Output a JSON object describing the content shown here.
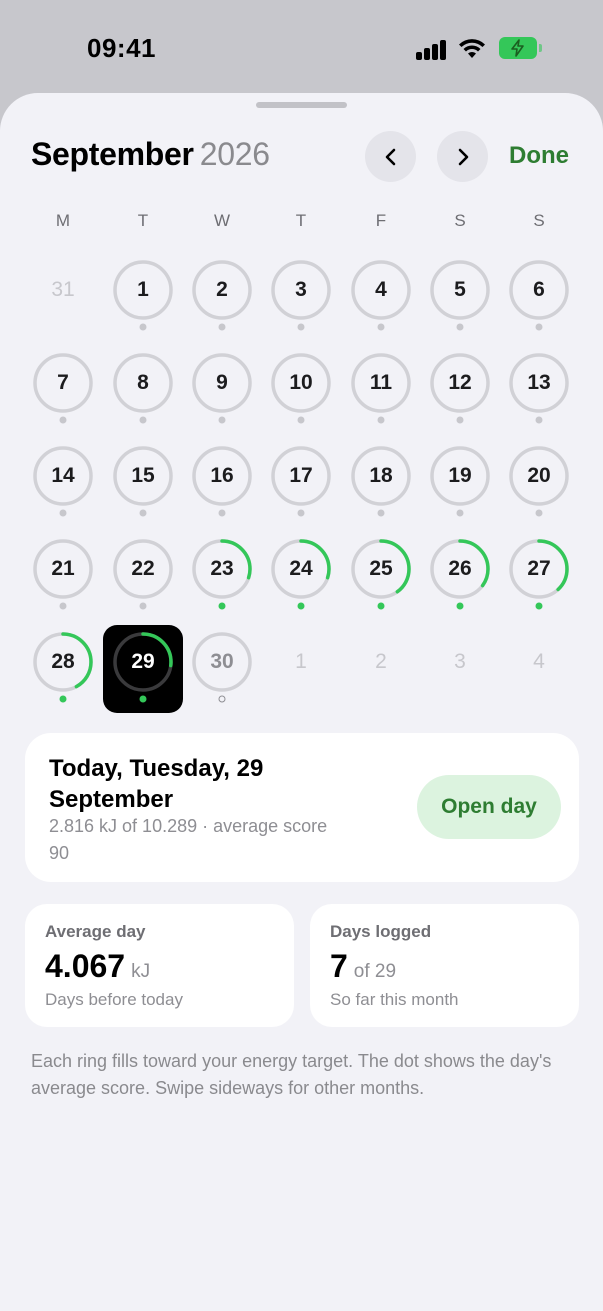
{
  "status_bar": {
    "time": "09:41"
  },
  "header": {
    "month": "September",
    "year": "2026",
    "done_label": "Done"
  },
  "weekdays": [
    "M",
    "T",
    "W",
    "T",
    "F",
    "S",
    "S"
  ],
  "calendar": {
    "days": [
      {
        "label": "31",
        "kind": "other"
      },
      {
        "label": "1",
        "progress": 0,
        "dot": "gray"
      },
      {
        "label": "2",
        "progress": 0,
        "dot": "gray"
      },
      {
        "label": "3",
        "progress": 0,
        "dot": "gray"
      },
      {
        "label": "4",
        "progress": 0,
        "dot": "gray"
      },
      {
        "label": "5",
        "progress": 0,
        "dot": "gray"
      },
      {
        "label": "6",
        "progress": 0,
        "dot": "gray"
      },
      {
        "label": "7",
        "progress": 0,
        "dot": "gray"
      },
      {
        "label": "8",
        "progress": 0,
        "dot": "gray"
      },
      {
        "label": "9",
        "progress": 0,
        "dot": "gray"
      },
      {
        "label": "10",
        "progress": 0,
        "dot": "gray"
      },
      {
        "label": "11",
        "progress": 0,
        "dot": "gray"
      },
      {
        "label": "12",
        "progress": 0,
        "dot": "gray"
      },
      {
        "label": "13",
        "progress": 0,
        "dot": "gray"
      },
      {
        "label": "14",
        "progress": 0,
        "dot": "gray"
      },
      {
        "label": "15",
        "progress": 0,
        "dot": "gray"
      },
      {
        "label": "16",
        "progress": 0,
        "dot": "gray"
      },
      {
        "label": "17",
        "progress": 0,
        "dot": "gray"
      },
      {
        "label": "18",
        "progress": 0,
        "dot": "gray"
      },
      {
        "label": "19",
        "progress": 0,
        "dot": "gray"
      },
      {
        "label": "20",
        "progress": 0,
        "dot": "gray"
      },
      {
        "label": "21",
        "progress": 0,
        "dot": "gray"
      },
      {
        "label": "22",
        "progress": 0,
        "dot": "gray"
      },
      {
        "label": "23",
        "progress": 0.3,
        "dot": "green"
      },
      {
        "label": "24",
        "progress": 0.3,
        "dot": "green"
      },
      {
        "label": "25",
        "progress": 0.4,
        "dot": "green"
      },
      {
        "label": "26",
        "progress": 0.35,
        "dot": "green"
      },
      {
        "label": "27",
        "progress": 0.38,
        "dot": "green"
      },
      {
        "label": "28",
        "progress": 0.42,
        "dot": "green"
      },
      {
        "label": "29",
        "progress": 0.27,
        "dot": "green",
        "selected": true
      },
      {
        "label": "30",
        "progress": 0,
        "dot": "hollow",
        "kind": "future"
      },
      {
        "label": "1",
        "kind": "other"
      },
      {
        "label": "2",
        "kind": "other"
      },
      {
        "label": "3",
        "kind": "other"
      },
      {
        "label": "4",
        "kind": "other"
      }
    ]
  },
  "today_card": {
    "title": "Today, Tuesday, 29 September",
    "subtitle": "2.816 kJ of 10.289 · average score 90",
    "open_day_label": "Open day"
  },
  "stats": {
    "average": {
      "label": "Average day",
      "value": "4.067",
      "unit": "kJ",
      "note": "Days before today"
    },
    "logged": {
      "label": "Days logged",
      "value": "7",
      "unit": "of 29",
      "note": "So far this month"
    }
  },
  "footnote": "Each ring fills toward your energy target. The dot shows the day's average score. Swipe sideways for other months.",
  "colors": {
    "accent": "#34c759",
    "done": "#2e7d32",
    "ring_track": "#d1d1d6",
    "sheet_bg": "#f2f2f7"
  }
}
